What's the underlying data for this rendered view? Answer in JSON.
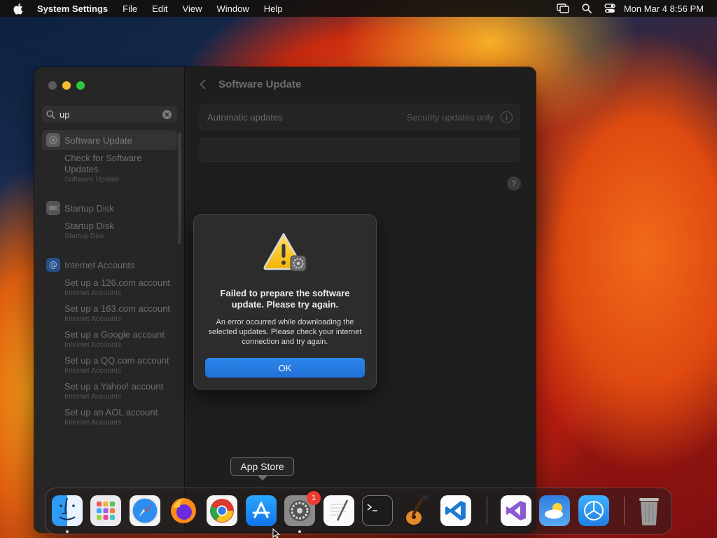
{
  "menubar": {
    "app_name": "System Settings",
    "items": [
      "File",
      "Edit",
      "View",
      "Window",
      "Help"
    ],
    "clock": "Mon Mar 4  8:56 PM"
  },
  "sidebar": {
    "search_value": "up",
    "groups": [
      {
        "title": "Software Update",
        "icon": "gear-icon",
        "selected": true,
        "results": [
          {
            "title": "Check for Software Updates",
            "category": "Software Update"
          }
        ]
      },
      {
        "title": "Startup Disk",
        "icon": "disk-icon",
        "selected": false,
        "results": [
          {
            "title": "Startup Disk",
            "category": "Startup Disk"
          }
        ]
      },
      {
        "title": "Internet Accounts",
        "icon": "at-sign-icon",
        "selected": false,
        "results": [
          {
            "title": "Set up a 126.com account",
            "category": "Internet Accounts"
          },
          {
            "title": "Set up a 163.com account",
            "category": "Internet Accounts"
          },
          {
            "title": "Set up a Google account",
            "category": "Internet Accounts"
          },
          {
            "title": "Set up a QQ.com account",
            "category": "Internet Accounts"
          },
          {
            "title": "Set up a Yahoo! account",
            "category": "Internet Accounts"
          },
          {
            "title": "Set up an AOL account",
            "category": "Internet Accounts"
          }
        ]
      }
    ]
  },
  "content": {
    "title": "Software Update",
    "automatic_updates_label": "Automatic updates",
    "automatic_updates_value": "Security updates only",
    "help_label": "?"
  },
  "alert": {
    "title": "Failed to prepare the software update. Please try again.",
    "message": "An error occurred while downloading the selected updates. Please check your internet connection and try again.",
    "button": "OK"
  },
  "dock": {
    "tooltip": "App Store",
    "badge": "1",
    "apps": [
      "Finder",
      "Launchpad",
      "Safari",
      "Firefox",
      "Google Chrome",
      "App Store",
      "System Settings",
      "TextEdit",
      "Terminal",
      "GarageBand",
      "Visual Studio Code",
      "Visual Studio",
      "Weather",
      "Xcode",
      "Trash"
    ]
  },
  "colors": {
    "accent": "#1f6fd6",
    "badge": "#ef3b30",
    "window_bg": "#1e1e1e"
  }
}
